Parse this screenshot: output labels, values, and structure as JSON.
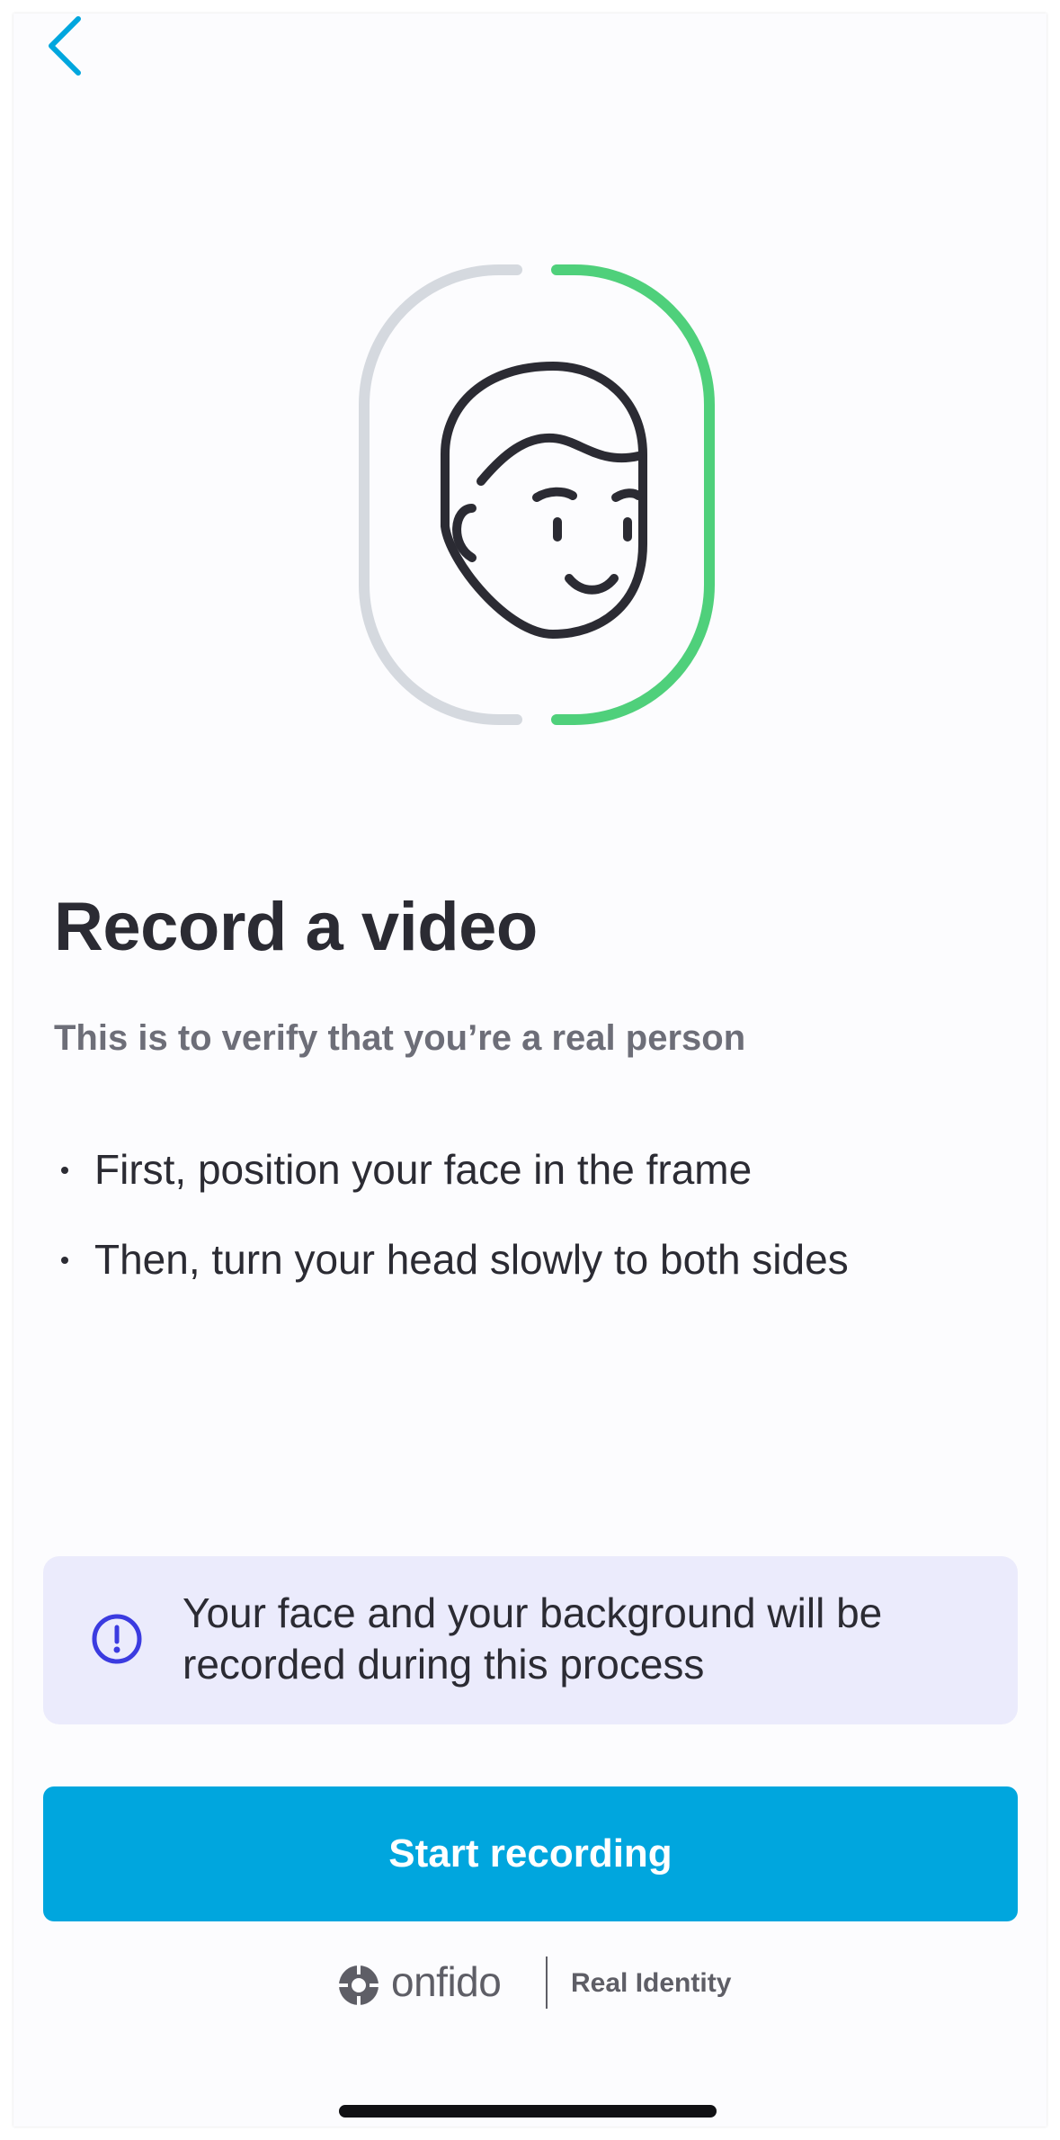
{
  "header": {
    "back_icon": "chevron-left-icon"
  },
  "illustration": {
    "icon": "face-frame-icon",
    "left_arc_color": "#d5d9df",
    "right_arc_color": "#4fd07b"
  },
  "content": {
    "title": "Record a video",
    "subtitle": "This is to verify that you’re a real person",
    "instructions": [
      "First, position your face in the frame",
      "Then, turn your head slowly to both sides"
    ]
  },
  "notice": {
    "icon": "info-alert-icon",
    "text": "Your face and your background will be recorded during this process"
  },
  "actions": {
    "start_label": "Start recording"
  },
  "footer": {
    "brand": "onfido",
    "tagline": "Real Identity"
  },
  "colors": {
    "accent": "#00a6de",
    "notice_bg": "#ebebfc",
    "notice_icon": "#3b3be0",
    "text": "#2b2b33",
    "muted": "#6d6e78"
  }
}
